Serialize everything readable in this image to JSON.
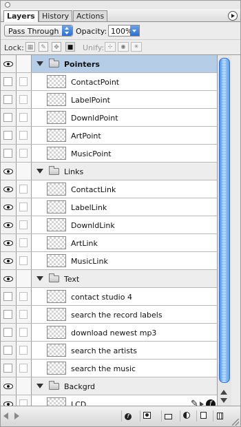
{
  "tabs": [
    {
      "label": "Layers",
      "active": true
    },
    {
      "label": "History",
      "active": false
    },
    {
      "label": "Actions",
      "active": false
    }
  ],
  "options": {
    "blend_mode": "Pass Through",
    "opacity_label": "Opacity:",
    "opacity_value": "100%"
  },
  "lock": {
    "label": "Lock:",
    "unify_label": "Unify:"
  },
  "groups": [
    {
      "name": "Pointers",
      "visible": true,
      "selected": true,
      "layers": [
        {
          "name": "ContactPoint",
          "visible": false
        },
        {
          "name": "LabelPoint",
          "visible": false
        },
        {
          "name": "DownldPoint",
          "visible": false
        },
        {
          "name": "ArtPoint",
          "visible": false
        },
        {
          "name": "MusicPoint",
          "visible": false
        }
      ]
    },
    {
      "name": "Links",
      "visible": true,
      "selected": false,
      "layers": [
        {
          "name": "ContactLink",
          "visible": true
        },
        {
          "name": "LabelLink",
          "visible": true
        },
        {
          "name": "DownldLink",
          "visible": true
        },
        {
          "name": "ArtLink",
          "visible": true
        },
        {
          "name": "MusicLink",
          "visible": true
        }
      ]
    },
    {
      "name": "Text",
      "visible": true,
      "selected": false,
      "layers": [
        {
          "name": "contact studio 4",
          "visible": false
        },
        {
          "name": "search the  record labels",
          "visible": false
        },
        {
          "name": "download newest mp3",
          "visible": false
        },
        {
          "name": "search the  artists",
          "visible": false
        },
        {
          "name": "search the  music",
          "visible": false
        }
      ]
    },
    {
      "name": "Backgrd",
      "visible": true,
      "selected": false,
      "layers": [
        {
          "name": "LCD",
          "visible": true,
          "has_effects": true,
          "effects_icon": "f"
        }
      ]
    }
  ]
}
